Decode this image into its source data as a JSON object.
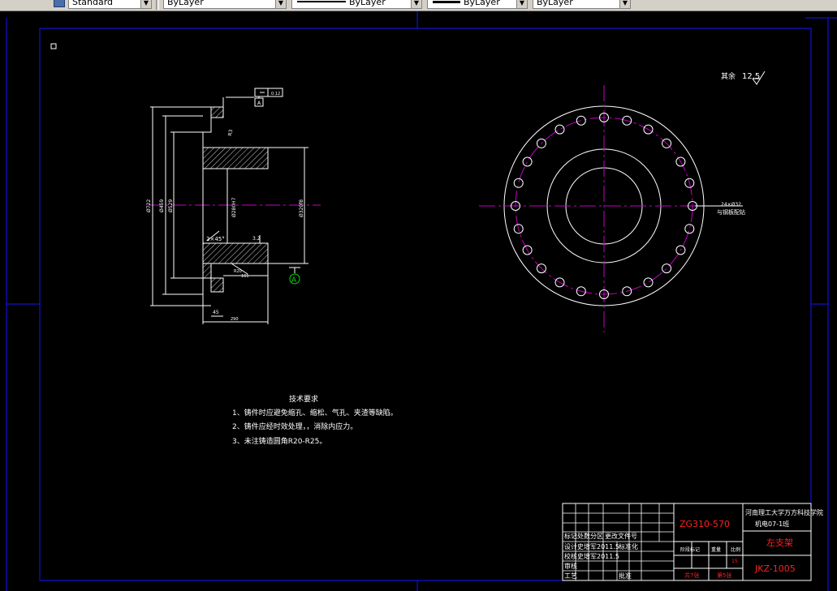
{
  "toolbar": {
    "text_style": "Standard",
    "layer": "ByLayer",
    "linetype": "ByLayer",
    "lineweight": "ByLayer",
    "plot_style": "ByLayer"
  },
  "drawing": {
    "surface_finish_note": {
      "label": "其余",
      "value": "12.5"
    },
    "tolerance_frame": {
      "value": "0.12",
      "datum": "A"
    },
    "datum_symbol": "A",
    "dimensions": {
      "outer_dia": "Ø722",
      "dia_2": "Ø459",
      "dia_3": "Ø529",
      "bore": "Ø280H7",
      "hub_dia": "Ø320f8",
      "chamfer": "2×45°",
      "length": "290",
      "width_165": "165",
      "flange_thk": "45",
      "fillet_r": "R3",
      "angle_r": "3.2",
      "holes": "24×Ø32",
      "holes_note": "与钢板配钻"
    },
    "tech_requirements": {
      "title": "技术要求",
      "items": [
        "1、铸件时应避免缩孔、缩松、气孔、夹渣等缺陷。",
        "2、铸件应经时效处理，，消除内应力。",
        "3、未注铸造圆角R20-R25。"
      ]
    },
    "title_block": {
      "material": "ZG310-570",
      "school": "河南理工大学万方科技学院",
      "class": "机电07-1班",
      "part_name": "左支架",
      "drawing_no": "JKZ-1005",
      "stage_label": "阶段标记",
      "weight_label": "重量",
      "scale_label": "比例",
      "scale_value": "15",
      "total_sheets": "共7张",
      "sheet_no": "第5张",
      "rows": [
        [
          "标记",
          "处数",
          "分区",
          "更改文件号"
        ],
        [
          "设计",
          "史增军",
          "2011.5",
          "标准化"
        ],
        [
          "校核",
          "史增军",
          "2011.5"
        ],
        [
          "审核"
        ],
        [
          "工艺",
          "",
          "",
          "批准"
        ]
      ]
    }
  }
}
